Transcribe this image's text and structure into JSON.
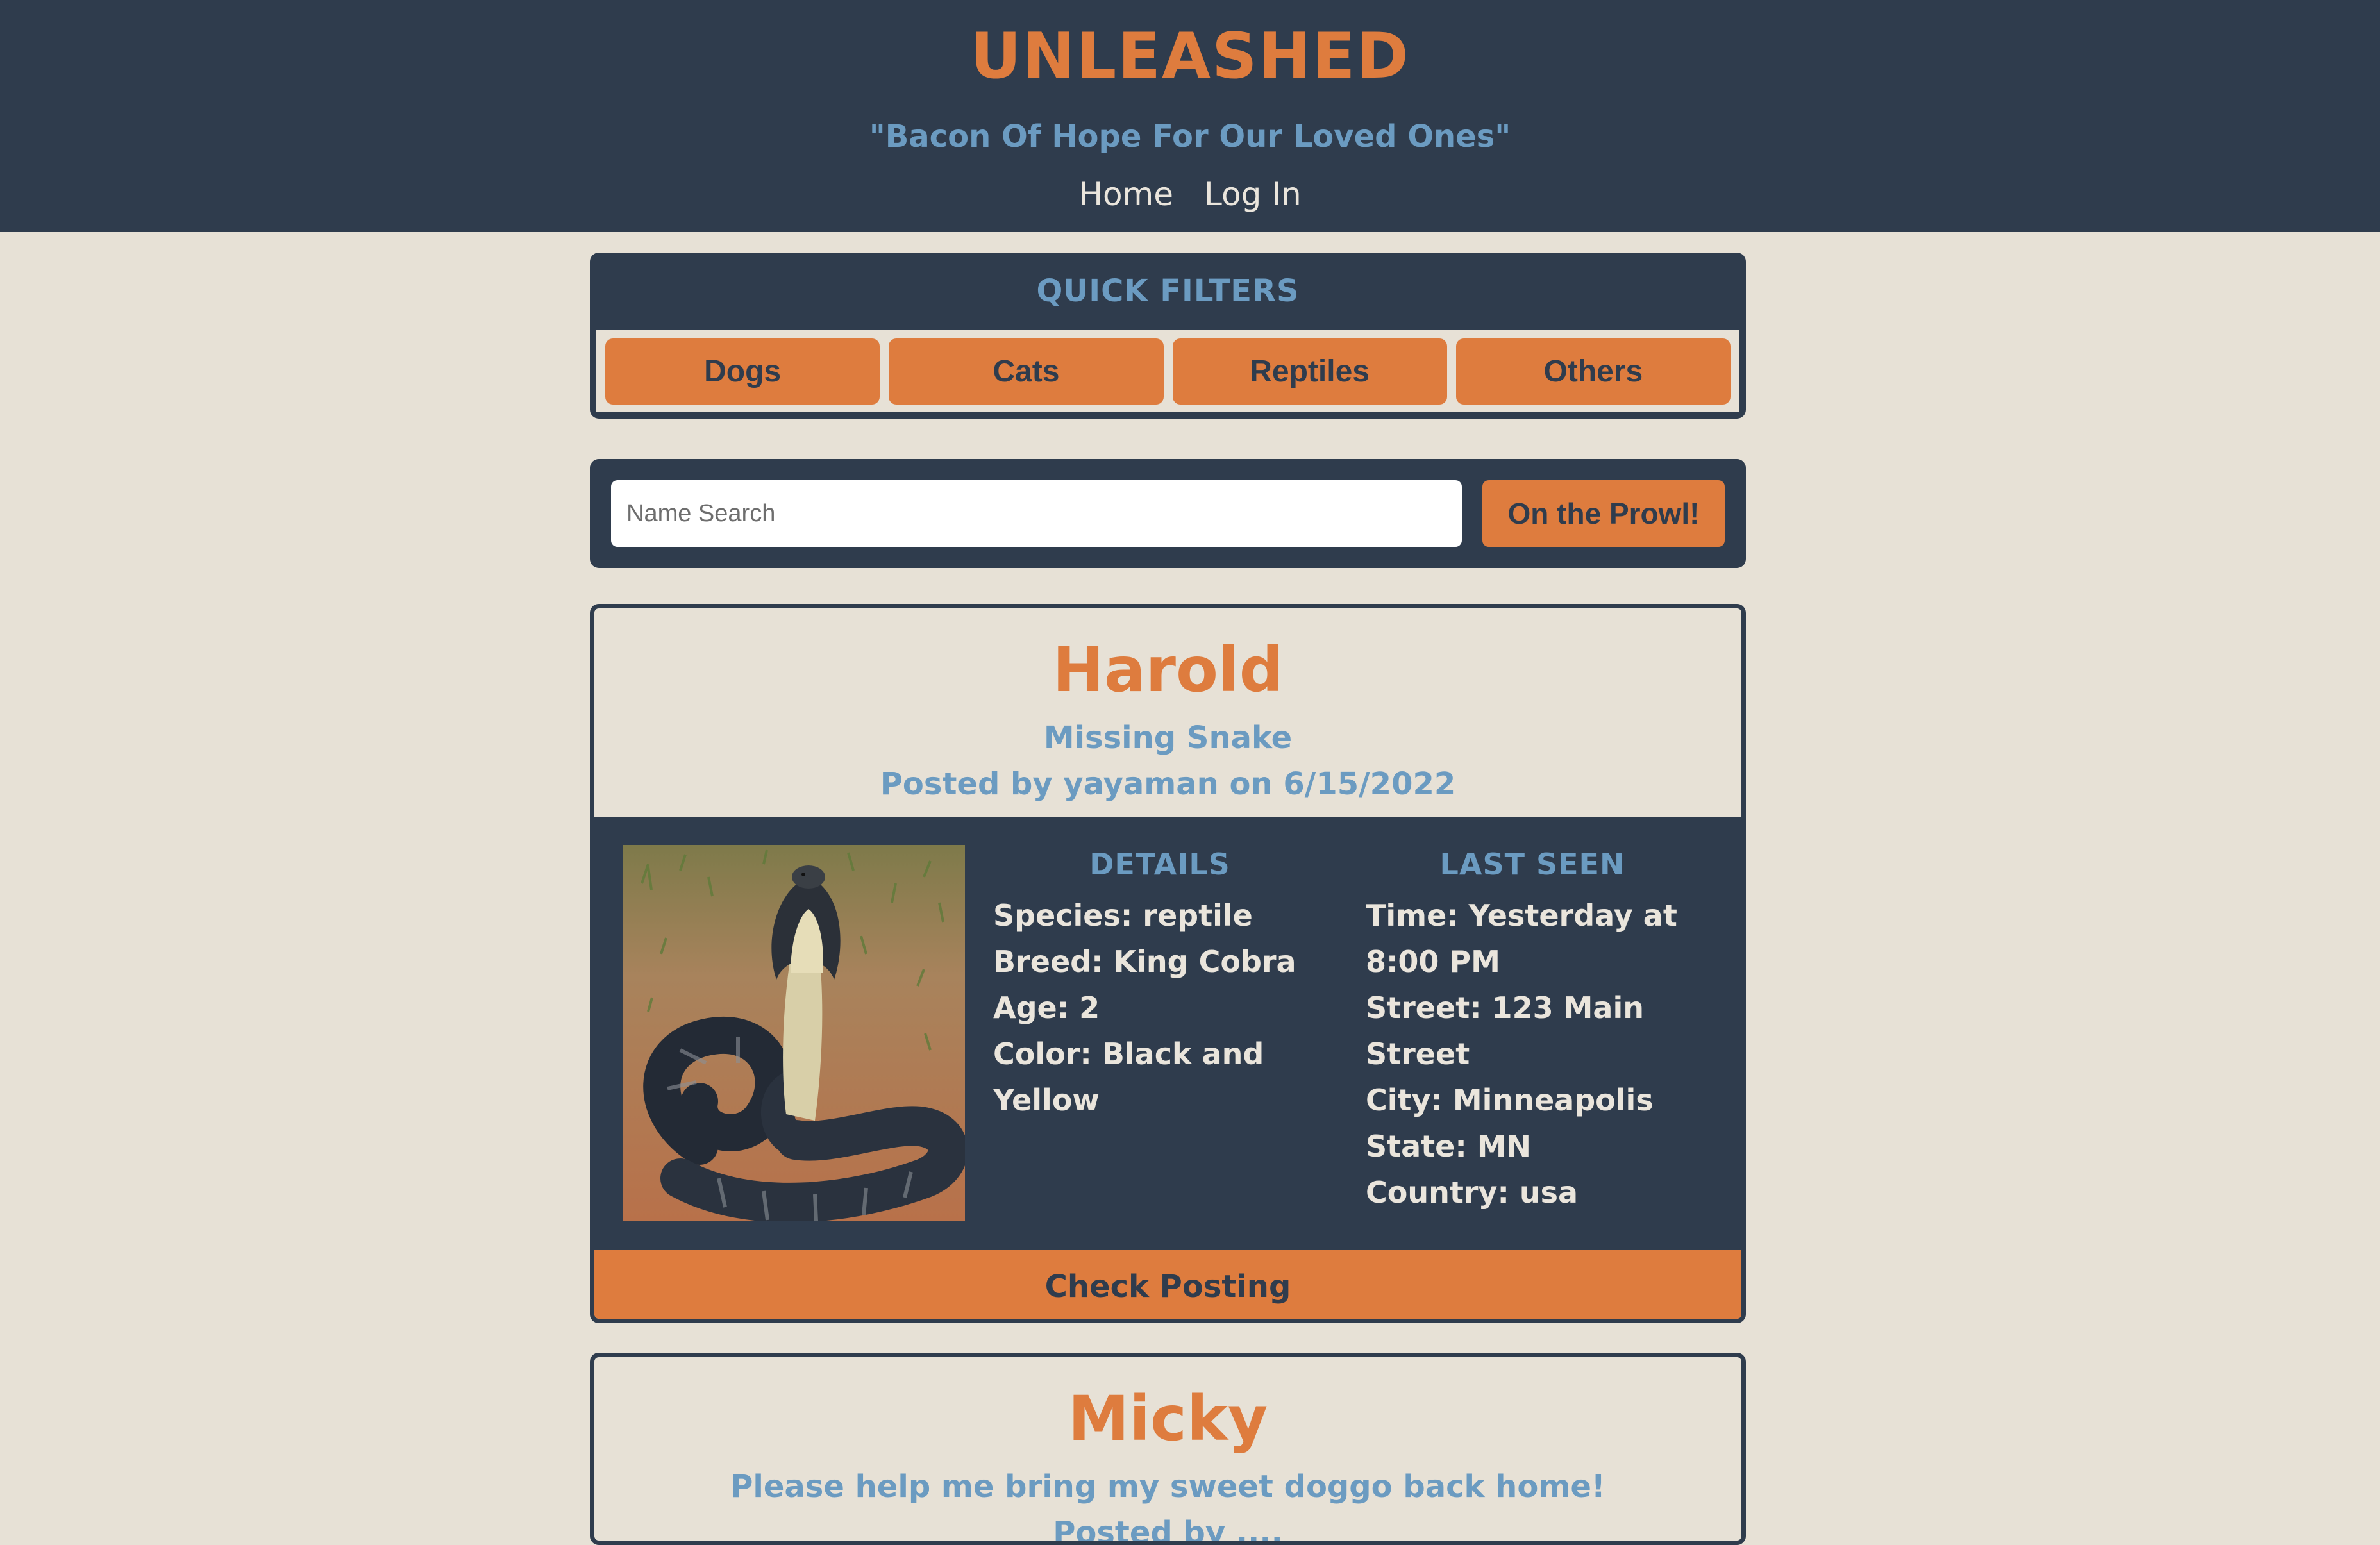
{
  "header": {
    "title": "UNLEASHED",
    "tagline": "\"Bacon Of Hope For Our Loved Ones\"",
    "nav": [
      "Home",
      "Log In"
    ]
  },
  "filters": {
    "title": "QUICK FILTERS",
    "buttons": [
      "Dogs",
      "Cats",
      "Reptiles",
      "Others"
    ]
  },
  "search": {
    "placeholder": "Name Search",
    "button_label": "On the Prowl!"
  },
  "posts": [
    {
      "name": "Harold",
      "subtitle": "Missing Snake",
      "byline": "Posted by yayaman on 6/15/2022",
      "details_heading": "DETAILS",
      "details": [
        "Species: reptile",
        "Breed: King Cobra",
        "Age: 2",
        "Color: Black and Yellow"
      ],
      "last_seen_heading": "LAST SEEN",
      "last_seen": [
        "Time: Yesterday at 8:00 PM",
        "Street: 123 Main Street",
        "City: Minneapolis",
        "State: MN",
        "Country: usa"
      ],
      "action_label": "Check Posting"
    },
    {
      "name": "Micky",
      "subtitle": "Please help me bring my sweet doggo back home!",
      "byline": "Posted by ...."
    }
  ],
  "colors": {
    "header_bg": "#2f3c4d",
    "page_bg": "#e7e1d6",
    "accent": "#de7c3e",
    "muted_blue": "#6b9bc1",
    "light_text": "#eae5dc"
  }
}
